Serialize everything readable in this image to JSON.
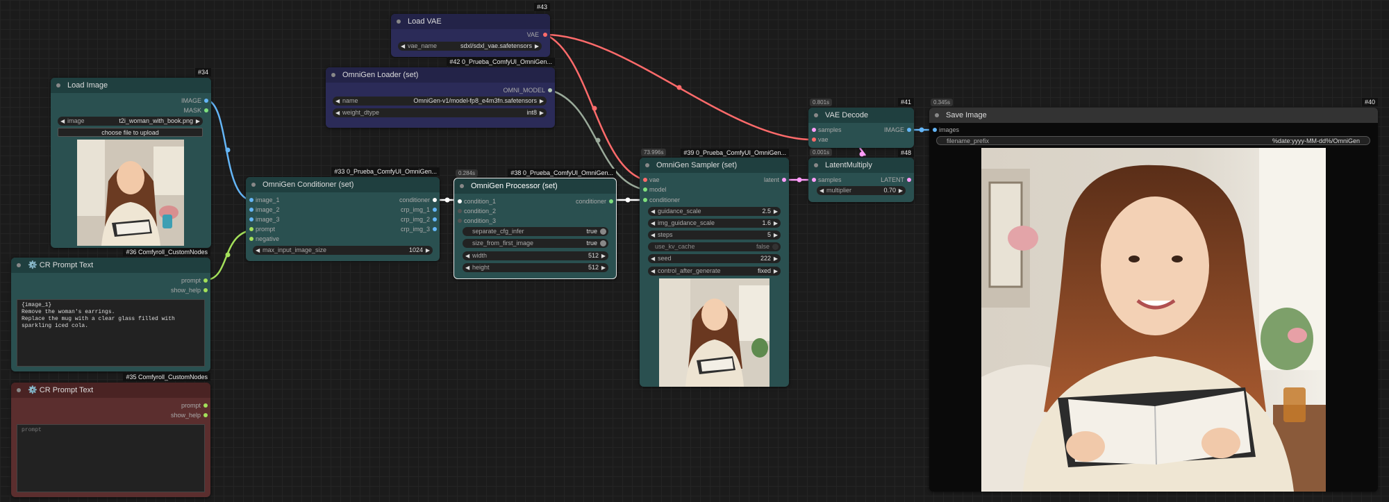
{
  "nodes": {
    "load_vae": {
      "id": "#43",
      "title": "Load VAE",
      "output": "VAE",
      "widget_label": "vae_name",
      "widget_value": "sdxl/sdxl_vae.safetensors"
    },
    "omnigen_loader": {
      "id": "#42 0_Prueba_ComfyUI_OmniGen...",
      "title": "OmniGen Loader (set)",
      "output": "OMNI_MODEL",
      "w1_label": "name",
      "w1_value": "OmniGen-v1/model-fp8_e4m3fn.safetensors",
      "w2_label": "weight_dtype",
      "w2_value": "int8"
    },
    "load_image": {
      "id": "#34",
      "title": "Load Image",
      "out1": "IMAGE",
      "out2": "MASK",
      "w_label": "image",
      "w_value": "t2i_woman_with_book.png",
      "upload": "choose file to upload"
    },
    "cr_prompt_1": {
      "id": "#36 Comfyroll_CustomNodes",
      "title": "⚙️ CR Prompt Text",
      "out1": "prompt",
      "out2": "show_help",
      "text": "{image_1}\nRemove the woman's earrings.\nReplace the mug with a clear glass filled with sparkling iced cola."
    },
    "cr_prompt_2": {
      "id": "#35 Comfyroll_CustomNodes",
      "title": "⚙️ CR Prompt Text",
      "out1": "prompt",
      "out2": "show_help",
      "placeholder": "prompt"
    },
    "conditioner": {
      "id": "#33 0_Prueba_ComfyUI_OmniGen...",
      "title": "OmniGen Conditioner (set)",
      "in1": "image_1",
      "in2": "image_2",
      "in3": "image_3",
      "in4": "prompt",
      "in5": "negative",
      "out1": "conditioner",
      "out2": "crp_img_1",
      "out3": "crp_img_2",
      "out4": "crp_img_3",
      "w_label": "max_input_image_size",
      "w_value": "1024"
    },
    "processor": {
      "id": "#38 0_Prueba_ComfyUI_OmniGen...",
      "time": "0.284s",
      "title": "OmniGen Processor (set)",
      "in1": "condition_1",
      "in2": "condition_2",
      "in3": "condition_3",
      "out1": "conditioner",
      "w1_label": "separate_cfg_infer",
      "w1_value": "true",
      "w2_label": "size_from_first_image",
      "w2_value": "true",
      "w3_label": "width",
      "w3_value": "512",
      "w4_label": "height",
      "w4_value": "512"
    },
    "sampler": {
      "id": "#39 0_Prueba_ComfyUI_OmniGen...",
      "time": "73.996s",
      "title": "OmniGen Sampler (set)",
      "in1": "vae",
      "in2": "model",
      "in3": "conditioner",
      "out1": "latent",
      "w1_label": "guidance_scale",
      "w1_value": "2.5",
      "w2_label": "img_guidance_scale",
      "w2_value": "1.6",
      "w3_label": "steps",
      "w3_value": "5",
      "w4_label": "use_kv_cache",
      "w4_value": "false",
      "w5_label": "seed",
      "w5_value": "222",
      "w6_label": "control_after_generate",
      "w6_value": "fixed"
    },
    "vae_decode": {
      "id": "#41",
      "time": "0.801s",
      "title": "VAE Decode",
      "in1": "samples",
      "in2": "vae",
      "out1": "IMAGE"
    },
    "latent_multiply": {
      "id": "#48",
      "time": "0.001s",
      "title": "LatentMultiply",
      "in1": "samples",
      "out1": "LATENT",
      "w_label": "multiplier",
      "w_value": "0.70"
    },
    "save_image": {
      "id": "#40",
      "time": "0.345s",
      "title": "Save Image",
      "in1": "images",
      "w_label": "filename_prefix",
      "w_value": "%date:yyyy-MM-dd%/OmniGen"
    }
  },
  "colors": {
    "vae": "#ff6b6b",
    "model": "#b4c8b4",
    "image": "#64b5f6",
    "conditioning": "#ffffff",
    "latent": "#ff9cf9",
    "string": "#a3e05a"
  }
}
